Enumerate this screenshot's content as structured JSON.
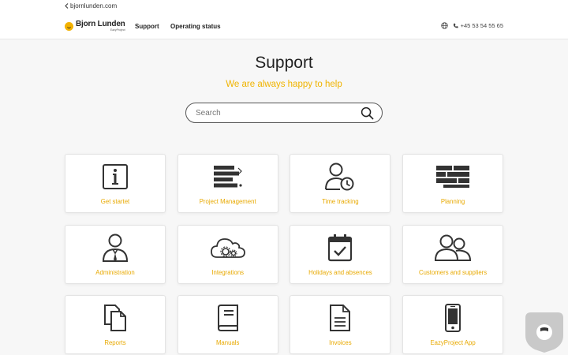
{
  "topbar": {
    "back_label": "bjornlunden.com"
  },
  "navbar": {
    "logo_name": "Bjorn Lunden",
    "logo_sub": "EazyProject",
    "links": [
      "Support",
      "Operating status"
    ],
    "phone": "+45 53 54 55 65"
  },
  "hero": {
    "title": "Support",
    "subtitle": "We are always happy to help"
  },
  "search": {
    "placeholder": "Search"
  },
  "cards": [
    {
      "label": "Get startet",
      "icon": "info-icon"
    },
    {
      "label": "Project Management",
      "icon": "project-bars-icon"
    },
    {
      "label": "Time tracking",
      "icon": "user-clock-icon"
    },
    {
      "label": "Planning",
      "icon": "planning-bricks-icon"
    },
    {
      "label": "Administration",
      "icon": "admin-user-icon"
    },
    {
      "label": "Integrations",
      "icon": "cloud-gears-icon"
    },
    {
      "label": "Holidays and absences",
      "icon": "calendar-check-icon"
    },
    {
      "label": "Customers and suppliers",
      "icon": "users-icon"
    },
    {
      "label": "Reports",
      "icon": "documents-icon"
    },
    {
      "label": "Manuals",
      "icon": "book-icon"
    },
    {
      "label": "Invoices",
      "icon": "invoice-icon"
    },
    {
      "label": "EazyProject App",
      "icon": "mobile-phone-icon"
    }
  ],
  "colors": {
    "accent": "#f0b400",
    "text": "#222222",
    "background": "#f7f7f7"
  }
}
